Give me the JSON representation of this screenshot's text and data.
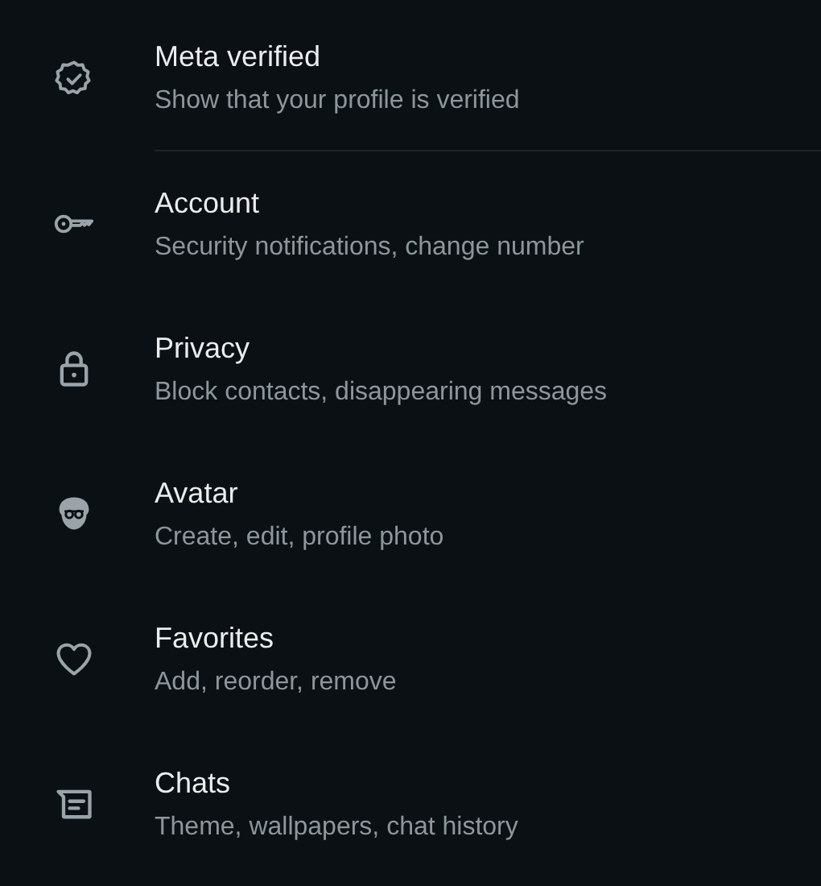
{
  "settings_items": [
    {
      "kind": "verified",
      "title": "Meta verified",
      "subtitle": "Show that your profile is verified",
      "divider": true
    },
    {
      "kind": "key",
      "title": "Account",
      "subtitle": "Security notifications, change number",
      "divider": false
    },
    {
      "kind": "lock",
      "title": "Privacy",
      "subtitle": "Block contacts, disappearing messages",
      "divider": false
    },
    {
      "kind": "avatar",
      "title": "Avatar",
      "subtitle": "Create, edit, profile photo",
      "divider": false
    },
    {
      "kind": "heart",
      "title": "Favorites",
      "subtitle": "Add, reorder, remove",
      "divider": false
    },
    {
      "kind": "chats",
      "title": "Chats",
      "subtitle": "Theme, wallpapers, chat history",
      "divider": false
    }
  ]
}
